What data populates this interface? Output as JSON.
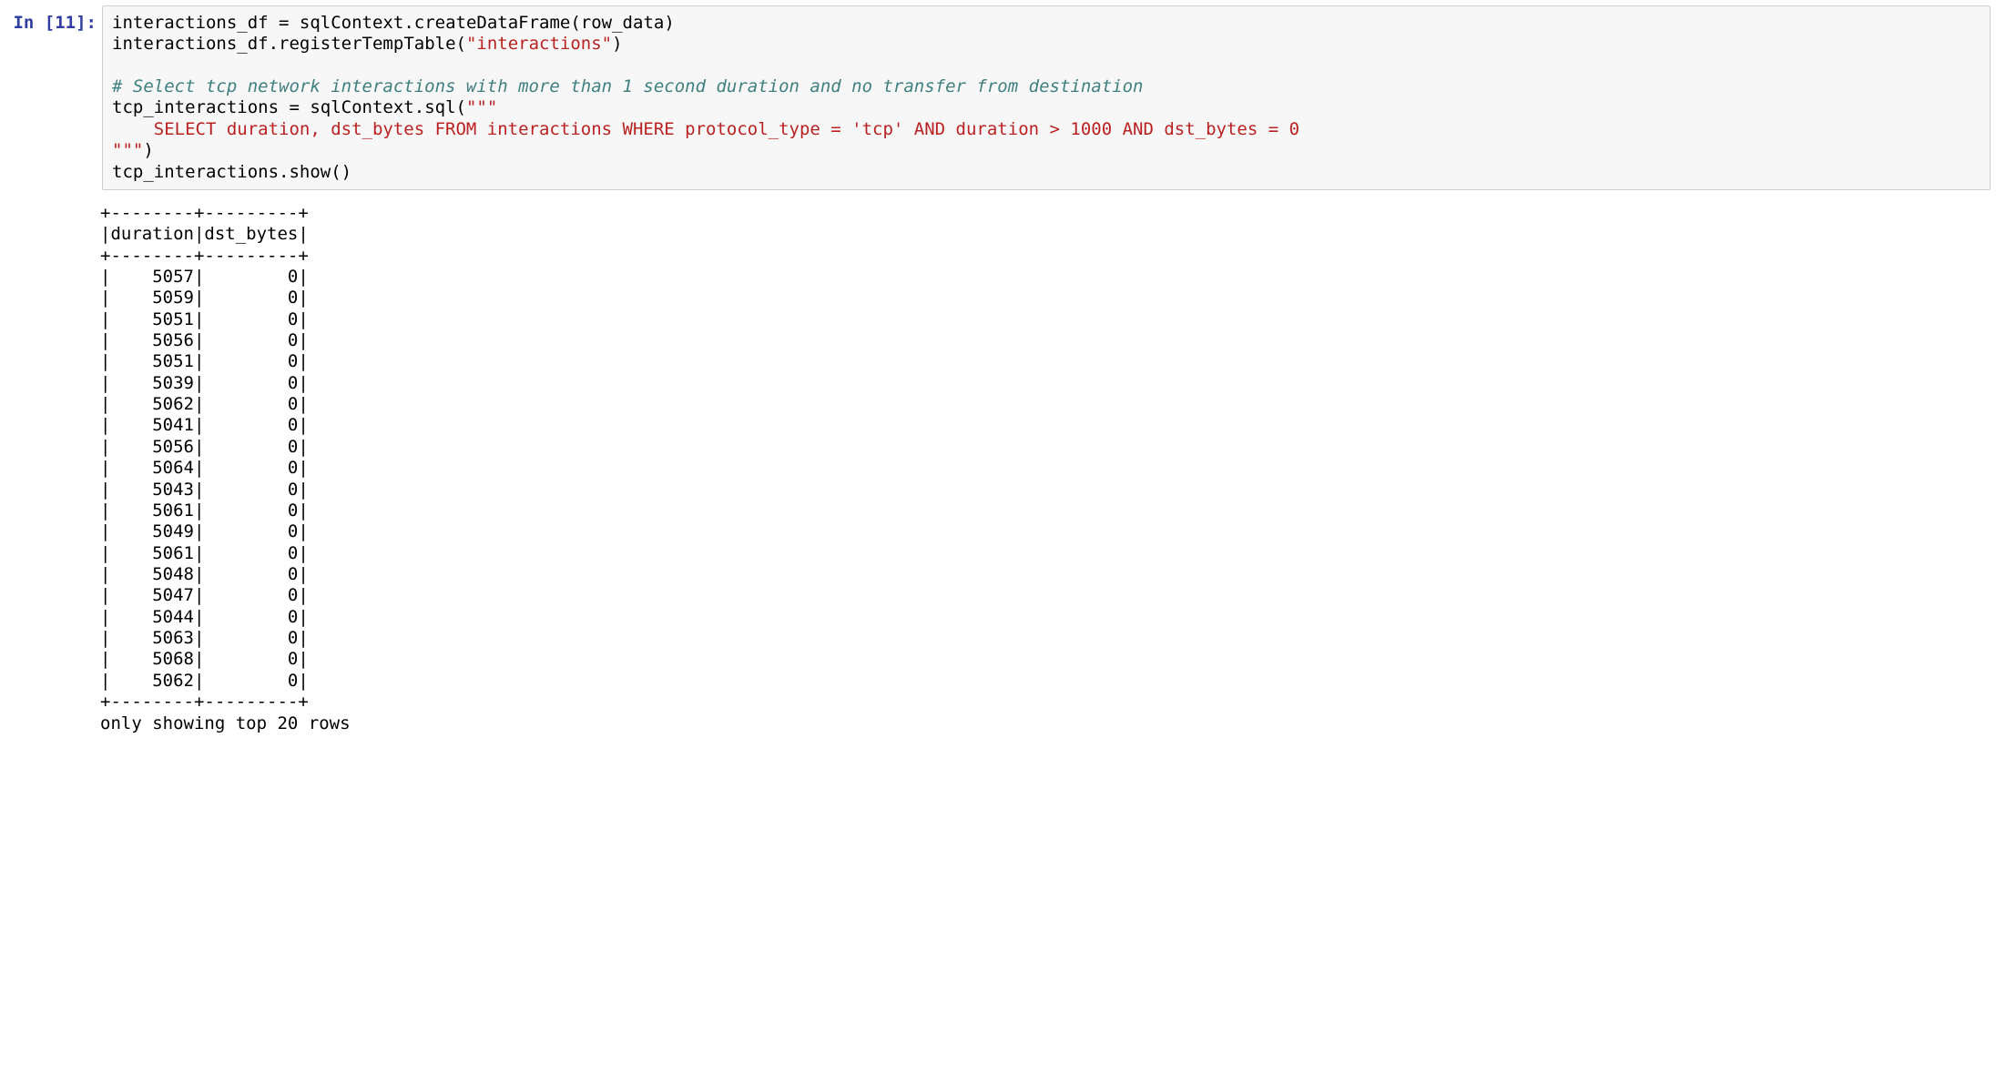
{
  "cell": {
    "prompt_prefix": "In [",
    "prompt_number": "11",
    "prompt_suffix": "]:",
    "code": {
      "l1a": "interactions_df ",
      "l1b": "=",
      "l1c": " sqlContext",
      "l1d": ".",
      "l1e": "createDataFrame(row_data)",
      "l2a": "interactions_df",
      "l2b": ".",
      "l2c": "registerTempTable(",
      "l2d": "\"interactions\"",
      "l2e": ")",
      "l3": "",
      "l4": "# Select tcp network interactions with more than 1 second duration and no transfer from destination",
      "l5a": "tcp_interactions ",
      "l5b": "=",
      "l5c": " sqlContext",
      "l5d": ".",
      "l5e": "sql(",
      "l5f": "\"\"\"",
      "l6": "    SELECT duration, dst_bytes FROM interactions WHERE protocol_type = 'tcp' AND duration > 1000 AND dst_bytes = 0",
      "l7a": "\"\"\"",
      "l7b": ")",
      "l8a": "tcp_interactions",
      "l8b": ".",
      "l8c": "show()"
    }
  },
  "output": {
    "header_border": "+--------+---------+",
    "header_row": "|duration|dst_bytes|",
    "rows": [
      {
        "duration": "5057",
        "dst_bytes": "0"
      },
      {
        "duration": "5059",
        "dst_bytes": "0"
      },
      {
        "duration": "5051",
        "dst_bytes": "0"
      },
      {
        "duration": "5056",
        "dst_bytes": "0"
      },
      {
        "duration": "5051",
        "dst_bytes": "0"
      },
      {
        "duration": "5039",
        "dst_bytes": "0"
      },
      {
        "duration": "5062",
        "dst_bytes": "0"
      },
      {
        "duration": "5041",
        "dst_bytes": "0"
      },
      {
        "duration": "5056",
        "dst_bytes": "0"
      },
      {
        "duration": "5064",
        "dst_bytes": "0"
      },
      {
        "duration": "5043",
        "dst_bytes": "0"
      },
      {
        "duration": "5061",
        "dst_bytes": "0"
      },
      {
        "duration": "5049",
        "dst_bytes": "0"
      },
      {
        "duration": "5061",
        "dst_bytes": "0"
      },
      {
        "duration": "5048",
        "dst_bytes": "0"
      },
      {
        "duration": "5047",
        "dst_bytes": "0"
      },
      {
        "duration": "5044",
        "dst_bytes": "0"
      },
      {
        "duration": "5063",
        "dst_bytes": "0"
      },
      {
        "duration": "5068",
        "dst_bytes": "0"
      },
      {
        "duration": "5062",
        "dst_bytes": "0"
      }
    ],
    "footer_border": "+--------+---------+",
    "footer_note": "only showing top 20 rows"
  }
}
